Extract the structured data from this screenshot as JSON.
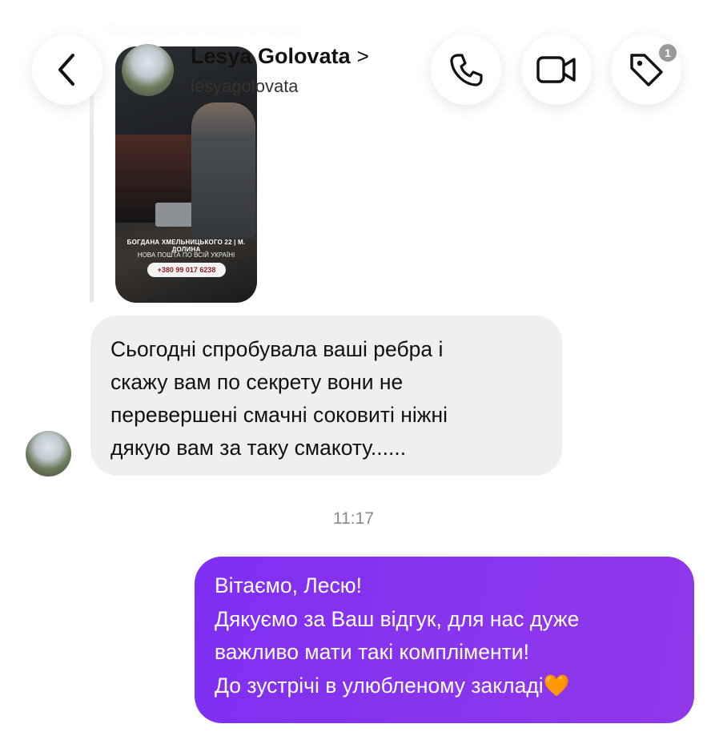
{
  "header": {
    "reply_context": "Відповідь на вашу історію",
    "name": "Lesya Golovata",
    "chevron": ">",
    "handle": "lesyagolovata",
    "tag_badge": "1"
  },
  "story": {
    "address": "БОГДАНА ХМЕЛЬНИЦЬКОГО 22 | М. ДОЛИНА",
    "delivery": "НОВА ПОШТА ПО ВСІЙ УКРАЇНІ",
    "phone": "+380 99 017 6238"
  },
  "incoming_message": {
    "lines": [
      "Сьогодні спробувала ваші ребра і",
      "скажу вам по секрету вони не",
      "перевершені смачні соковиті ніжні",
      "дякую вам за таку смакоту......"
    ]
  },
  "timestamp": "11:17",
  "outgoing_message": {
    "lines": [
      "Вітаємо, Лесю!",
      "Дякуємо за Ваш відгук, для нас дуже",
      "важливо мати такі компліменти!",
      "До зустрічі в улюбленому закладі🧡"
    ]
  },
  "colors": {
    "outgoing_bubble": "#8633f0",
    "incoming_bubble": "#efeff2",
    "timestamp": "#8a8a8e",
    "badge": "#9a9a9a"
  },
  "icons": [
    "back-chevron-icon",
    "phone-icon",
    "video-camera-icon",
    "tag-icon"
  ]
}
